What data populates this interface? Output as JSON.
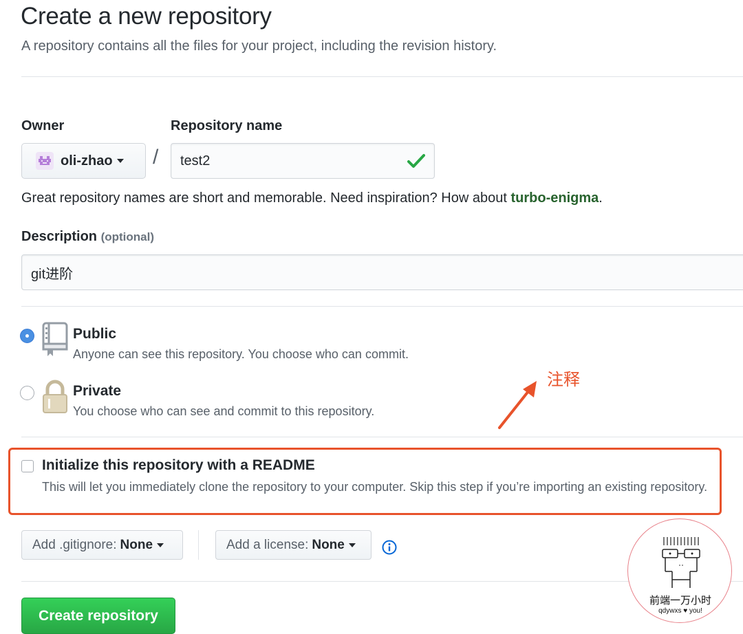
{
  "header": {
    "title": "Create a new repository",
    "subtitle": "A repository contains all the files for your project, including the revision history."
  },
  "owner": {
    "label": "Owner",
    "name": "oli-zhao",
    "avatar_icon": "avatar-icon"
  },
  "repo_name": {
    "label": "Repository name",
    "value": "test2",
    "separator": "/",
    "hint_prefix": "Great repository names are short and memorable. Need inspiration? How about ",
    "suggestion": "turbo-enigma",
    "hint_suffix": "."
  },
  "description": {
    "label": "Description",
    "optional": "(optional)",
    "value": "git进阶"
  },
  "visibility": {
    "selected": "public",
    "public_title": "Public",
    "public_desc": "Anyone can see this repository. You choose who can commit.",
    "private_title": "Private",
    "private_desc": "You choose who can see and commit to this repository."
  },
  "annotation": {
    "text": "注释",
    "color": "#e8532b"
  },
  "readme": {
    "checked": false,
    "title": "Initialize this repository with a README",
    "desc": "This will let you immediately clone the repository to your computer. Skip this step if you’re importing an existing repository."
  },
  "options": {
    "gitignore_label": "Add .gitignore:",
    "gitignore_value": "None",
    "license_label": "Add a license:",
    "license_value": "None",
    "info_icon": "info-icon"
  },
  "submit": {
    "label": "Create repository",
    "color": "#2ea44f"
  },
  "watermark": {
    "name": "前端一万小时",
    "tag_left": "qdywxs",
    "tag_heart": "♥",
    "tag_right": "you!"
  }
}
